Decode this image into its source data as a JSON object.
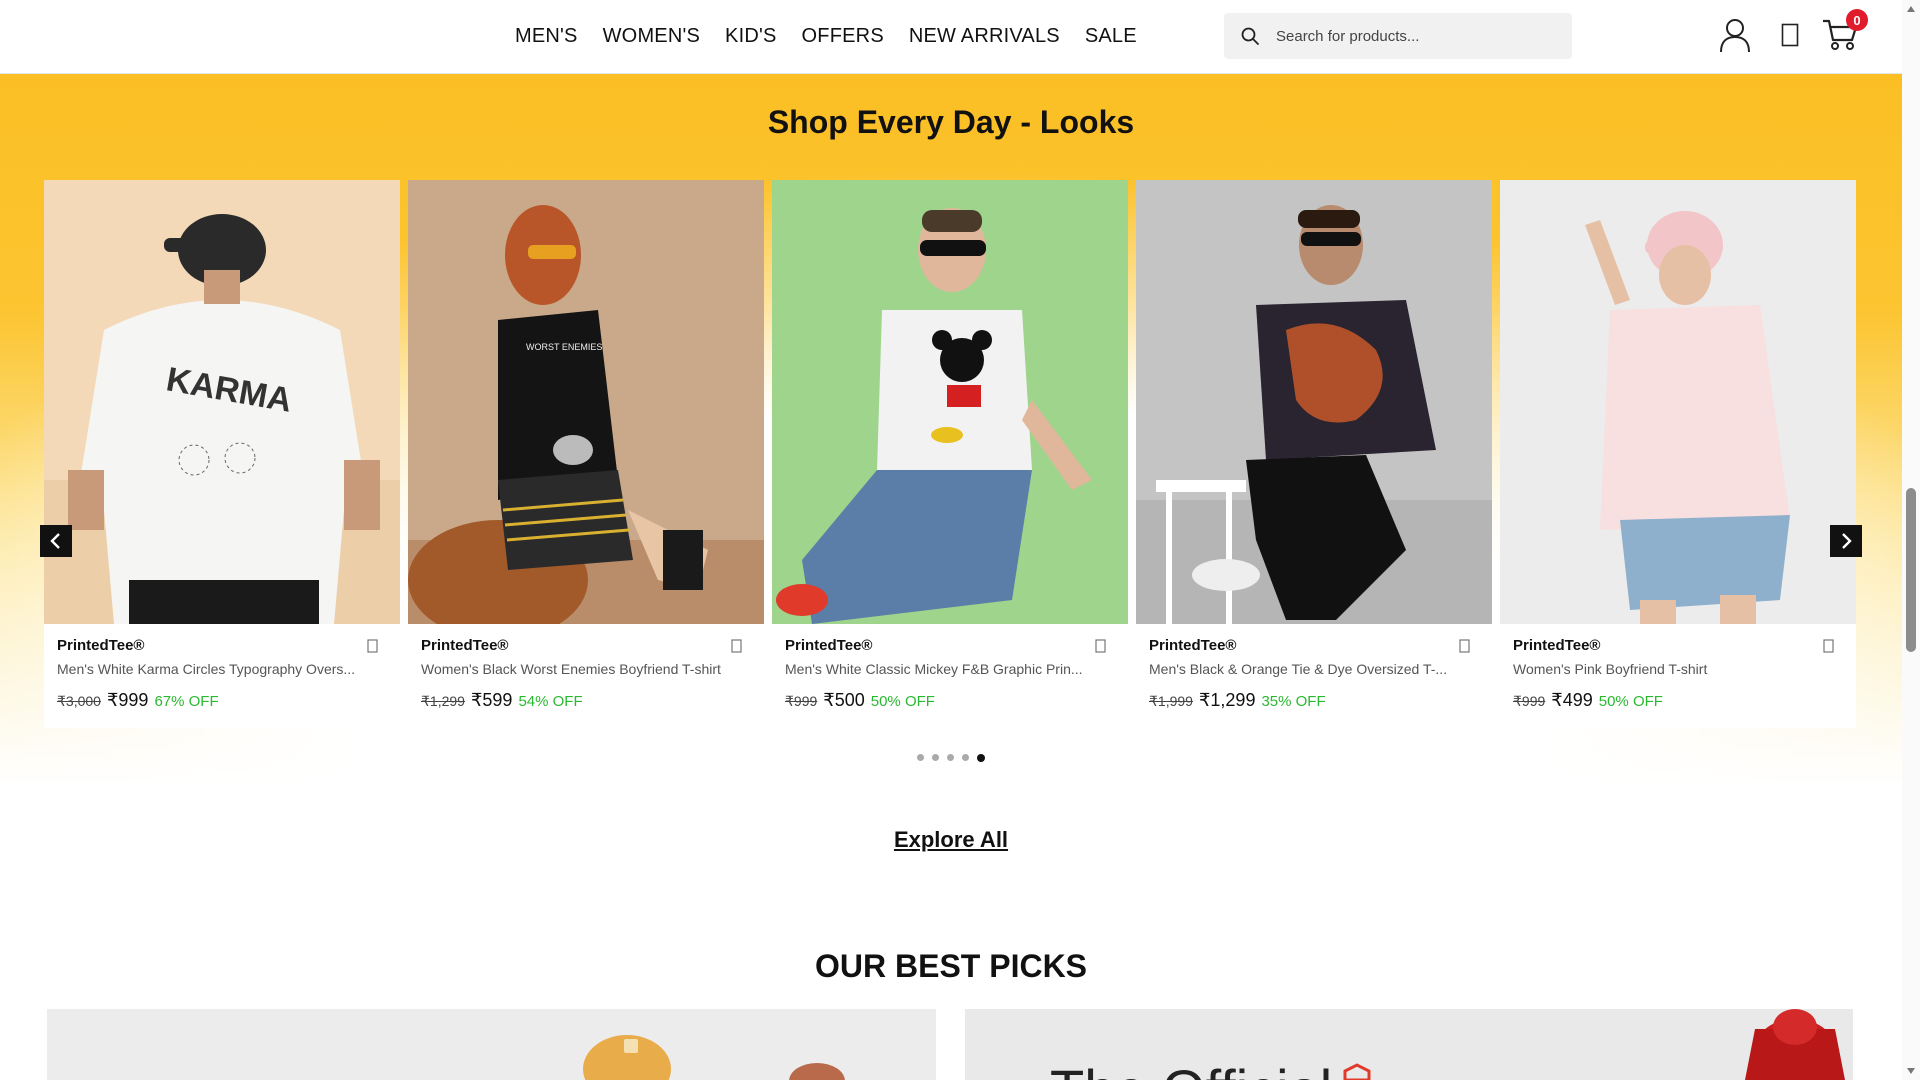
{
  "header": {
    "nav": [
      "MEN'S",
      "WOMEN'S",
      "KID'S",
      "OFFERS",
      "NEW ARRIVALS",
      "SALE"
    ],
    "search_placeholder": "Search for products...",
    "cart_count": "0"
  },
  "looks": {
    "title_prefix": "Shop Every Day - ",
    "title_bold": "Looks",
    "products": [
      {
        "brand": "PrintedTee®",
        "name": "Men's White Karma Circles Typography Overs...",
        "mrp": "₹3,000",
        "price": "₹999",
        "off": "67% OFF"
      },
      {
        "brand": "PrintedTee®",
        "name": "Women's Black Worst Enemies Boyfriend T-shirt",
        "mrp": "₹1,299",
        "price": "₹599",
        "off": "54% OFF"
      },
      {
        "brand": "PrintedTee®",
        "name": "Men's White Classic Mickey F&B Graphic Prin...",
        "mrp": "₹999",
        "price": "₹500",
        "off": "50% OFF"
      },
      {
        "brand": "PrintedTee®",
        "name": "Men's Black & Orange Tie & Dye Oversized T-...",
        "mrp": "₹1,999",
        "price": "₹1,299",
        "off": "35% OFF"
      },
      {
        "brand": "PrintedTee®",
        "name": "Women's Pink Boyfriend T-shirt",
        "mrp": "₹999",
        "price": "₹499",
        "off": "50% OFF"
      }
    ],
    "dots_total": 5,
    "dots_active": 5,
    "explore_label": "Explore All"
  },
  "best_picks": {
    "title_prefix": "OUR ",
    "title_bold": "BEST PICKS",
    "promo_partial": "The Official"
  }
}
